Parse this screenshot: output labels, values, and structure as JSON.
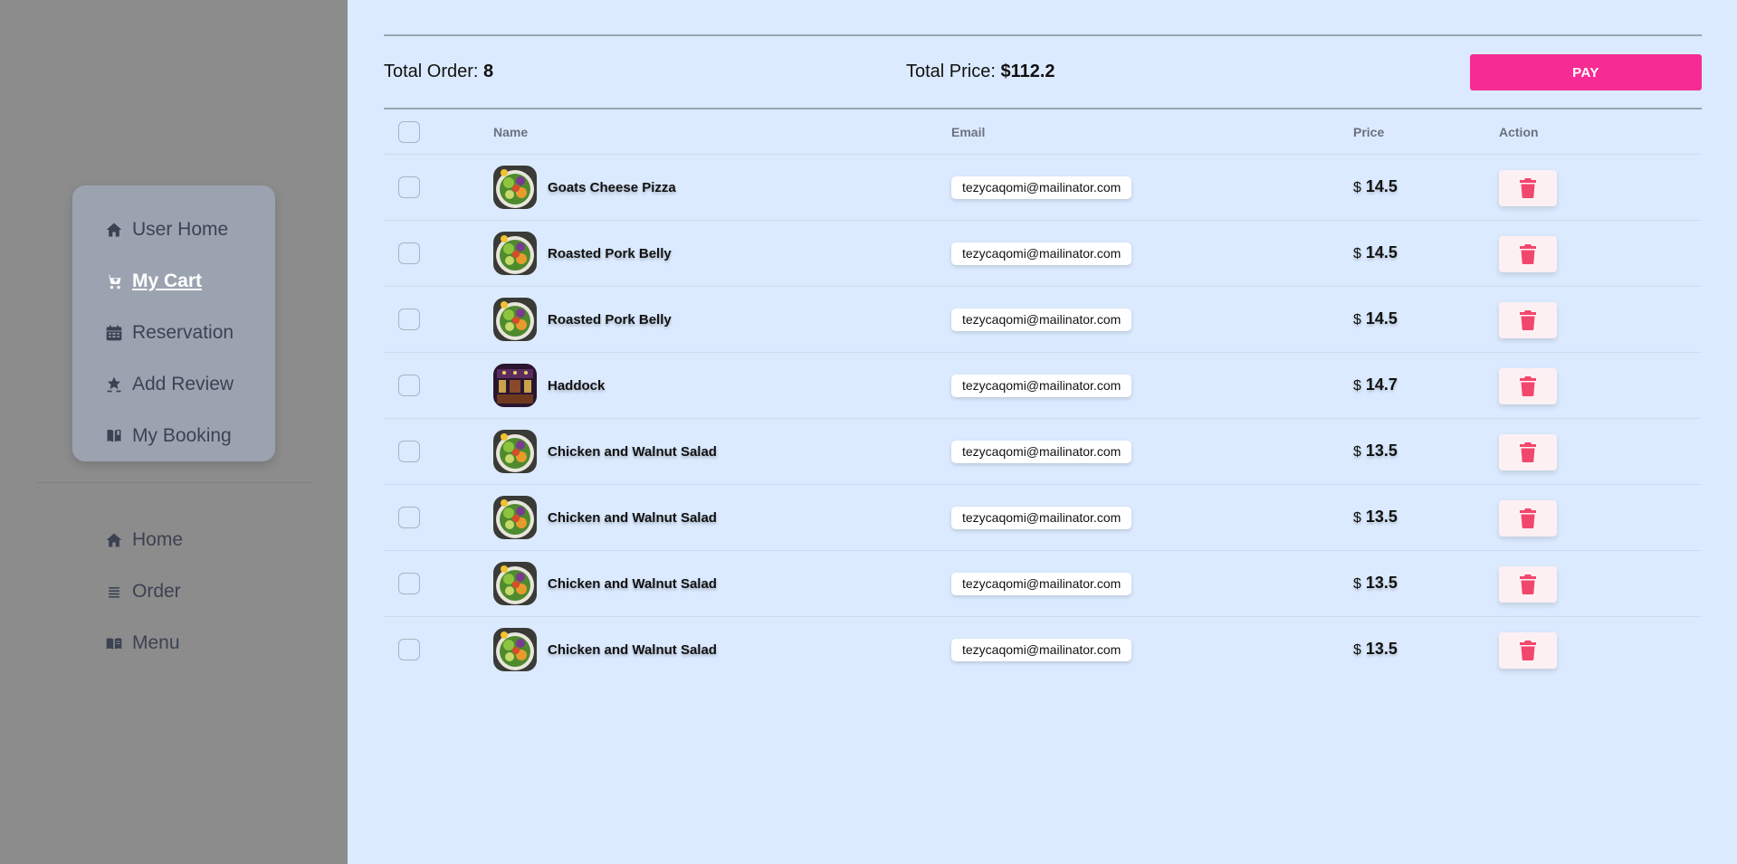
{
  "sidebar": {
    "primary": [
      {
        "label": "User Home",
        "icon": "home-icon",
        "active": false
      },
      {
        "label": "My Cart",
        "icon": "cart-icon",
        "active": true
      },
      {
        "label": "Reservation",
        "icon": "calendar-icon",
        "active": false
      },
      {
        "label": "Add Review",
        "icon": "review-icon",
        "active": false
      },
      {
        "label": "My Booking",
        "icon": "book-icon",
        "active": false
      }
    ],
    "secondary": [
      {
        "label": "Home",
        "icon": "home-icon"
      },
      {
        "label": "Order",
        "icon": "list-icon"
      },
      {
        "label": "Menu",
        "icon": "menu-book-icon"
      }
    ]
  },
  "summary": {
    "total_order_label": "Total Order: ",
    "total_order_value": "8",
    "total_price_label": "Total Price: ",
    "total_price_value": "$112.2",
    "pay_label": "PAY"
  },
  "table": {
    "headers": {
      "name": "Name",
      "email": "Email",
      "price": "Price",
      "action": "Action"
    },
    "currency": "$",
    "rows": [
      {
        "name": "Goats Cheese Pizza",
        "email": "tezycaqomi@mailinator.com",
        "price": "14.5",
        "image": "salad-image"
      },
      {
        "name": "Roasted Pork Belly",
        "email": "tezycaqomi@mailinator.com",
        "price": "14.5",
        "image": "salad-image"
      },
      {
        "name": "Roasted Pork Belly",
        "email": "tezycaqomi@mailinator.com",
        "price": "14.5",
        "image": "salad-image"
      },
      {
        "name": "Haddock",
        "email": "tezycaqomi@mailinator.com",
        "price": "14.7",
        "image": "restaurant-image"
      },
      {
        "name": "Chicken and Walnut Salad",
        "email": "tezycaqomi@mailinator.com",
        "price": "13.5",
        "image": "salad-image"
      },
      {
        "name": "Chicken and Walnut Salad",
        "email": "tezycaqomi@mailinator.com",
        "price": "13.5",
        "image": "salad-image"
      },
      {
        "name": "Chicken and Walnut Salad",
        "email": "tezycaqomi@mailinator.com",
        "price": "13.5",
        "image": "salad-image"
      },
      {
        "name": "Chicken and Walnut Salad",
        "email": "tezycaqomi@mailinator.com",
        "price": "13.5",
        "image": "salad-image"
      }
    ]
  },
  "colors": {
    "accent": "#f72b94",
    "delete": "#f2476c",
    "background": "#dbeafe",
    "sidebar": "#8c8c8c"
  }
}
